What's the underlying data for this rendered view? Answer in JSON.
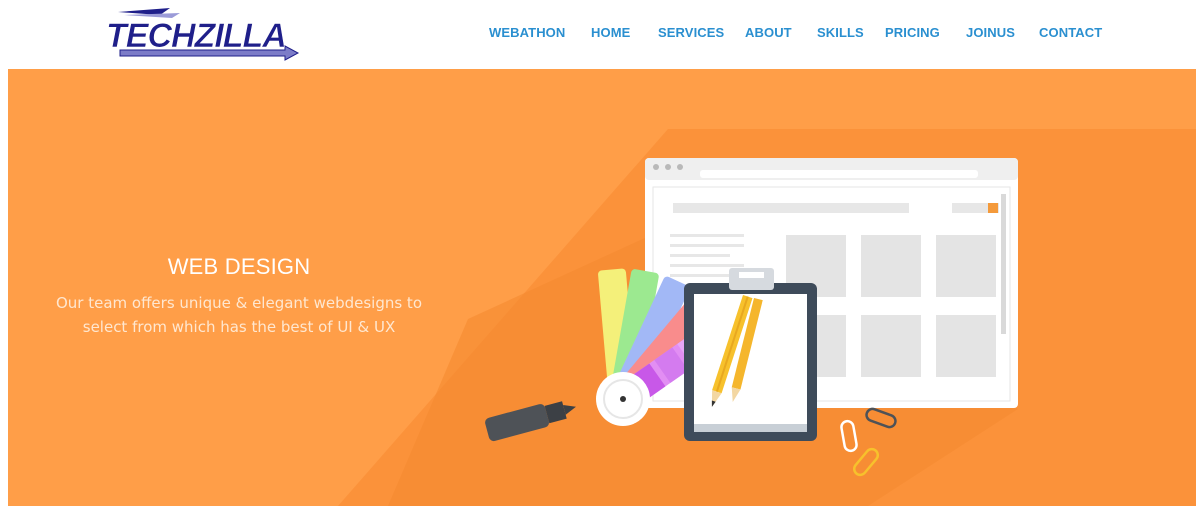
{
  "brand": {
    "logo_text": "TECHZILLA"
  },
  "nav": {
    "items": [
      {
        "label": "WEBATHON"
      },
      {
        "label": "HOME"
      },
      {
        "label": "SERVICES"
      },
      {
        "label": "ABOUT"
      },
      {
        "label": "SKILLS"
      },
      {
        "label": "PRICING"
      },
      {
        "label": "JOINUS"
      },
      {
        "label": "CONTACT"
      }
    ]
  },
  "hero": {
    "title": "WEB DESIGN",
    "description_line1": "Our team offers unique & elegant webdesigns to",
    "description_line2": "select from which has the best of UI & UX"
  },
  "colors": {
    "nav_text": "#2a8fd0",
    "hero_bg": "#ff9e48",
    "logo_blue": "#1f1f8a"
  },
  "icons": [
    "browser-window-icon",
    "color-swatch-fan-icon",
    "clipboard-icon",
    "pencil-icon",
    "marker-icon",
    "paperclip-icon"
  ]
}
